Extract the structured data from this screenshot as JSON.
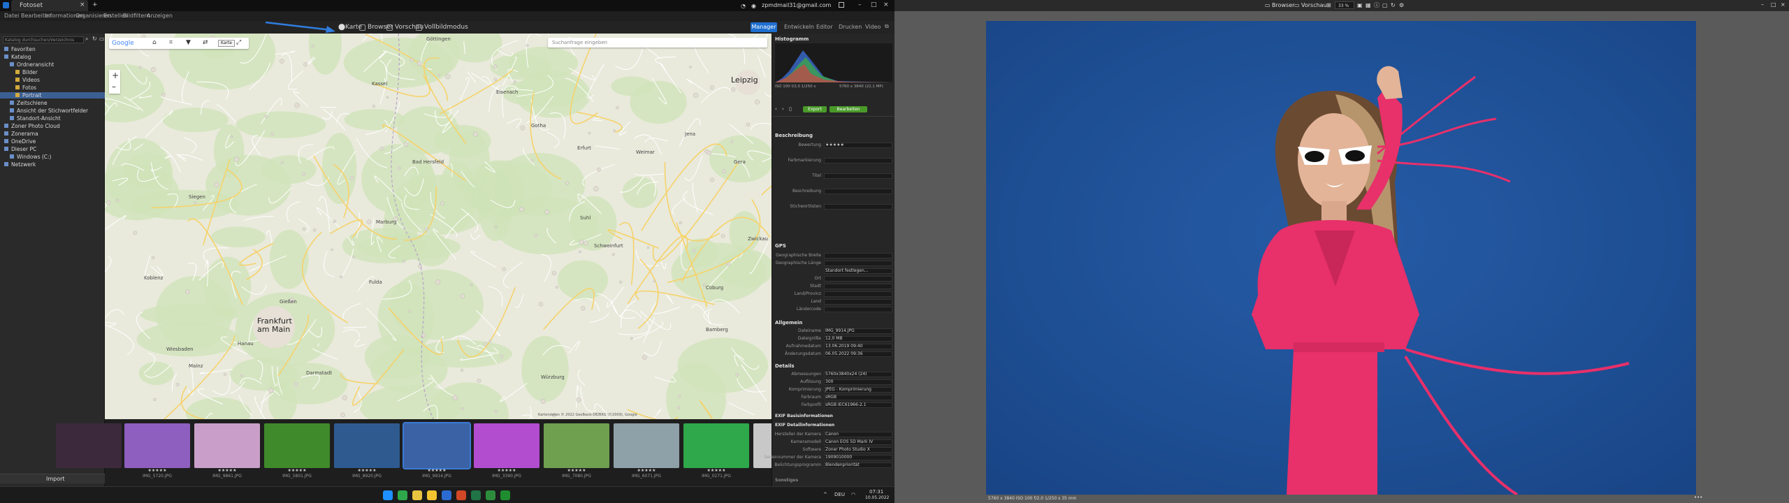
{
  "app": {
    "title": "Fotoset",
    "email": "zpmdmail31@gmail.com"
  },
  "menu": [
    "Datei",
    "Bearbeiten",
    "Informationen",
    "Organisieren",
    "Erstellen",
    "Bildfiltern",
    "Anzeigen"
  ],
  "toolbar": {
    "map": "Karte",
    "browser": "Browser",
    "preview": "Vorschau",
    "fullscreen": "Vollbildmodus",
    "tooltip": "Karte"
  },
  "modes": {
    "manager": "Manager",
    "develop": "Entwickeln",
    "editor": "Editor",
    "print": "Drucken",
    "video": "Video"
  },
  "sidebar": {
    "search_placeholder": "Katalog durchsuchen/Verzeichnis",
    "items": [
      {
        "label": "Favoriten",
        "sel": false,
        "indent": 0
      },
      {
        "label": "Katalog",
        "sel": false,
        "indent": 0
      },
      {
        "label": "Ordneransicht",
        "sel": false,
        "indent": 1
      },
      {
        "label": "Bilder",
        "sel": false,
        "indent": 2
      },
      {
        "label": "Videos",
        "sel": false,
        "indent": 2
      },
      {
        "label": "Fotos",
        "sel": false,
        "indent": 2
      },
      {
        "label": "Portrait",
        "sel": true,
        "indent": 2
      },
      {
        "label": "Zeitschiene",
        "sel": false,
        "indent": 1
      },
      {
        "label": "Ansicht der Stichwortfelder",
        "sel": false,
        "indent": 1
      },
      {
        "label": "Standort-Ansicht",
        "sel": false,
        "indent": 1
      },
      {
        "label": "Zoner Photo Cloud",
        "sel": false,
        "indent": 0
      },
      {
        "label": "Zonerama",
        "sel": false,
        "indent": 0
      },
      {
        "label": "OneDrive",
        "sel": false,
        "indent": 0
      },
      {
        "label": "Dieser PC",
        "sel": false,
        "indent": 0
      },
      {
        "label": "Windows (C:)",
        "sel": false,
        "indent": 1
      },
      {
        "label": "Netzwerk",
        "sel": false,
        "indent": 0
      }
    ],
    "import": "Import"
  },
  "map": {
    "search_placeholder": "Suchanfrage eingeben",
    "provider": "Google",
    "cities": [
      {
        "name": "Göttingen"
      },
      {
        "name": "Kassel"
      },
      {
        "name": "Erfurt"
      },
      {
        "name": "Marburg"
      },
      {
        "name": "Siegen"
      },
      {
        "name": "Koblenz"
      },
      {
        "name": "Fulda"
      },
      {
        "name": "Würzburg"
      },
      {
        "name": "Darmstadt"
      },
      {
        "name": "Mainz"
      },
      {
        "name": "Wiesbaden"
      },
      {
        "name": "Gießen"
      },
      {
        "name": "Eisenach"
      },
      {
        "name": "Gotha"
      },
      {
        "name": "Jena"
      },
      {
        "name": "Weimar"
      },
      {
        "name": "Gera"
      },
      {
        "name": "Zwickau"
      },
      {
        "name": "Hanau"
      },
      {
        "name": "Schweinfurt"
      },
      {
        "name": "Bamberg"
      },
      {
        "name": "Coburg"
      },
      {
        "name": "Suhl"
      },
      {
        "name": "Bad Hersfeld"
      }
    ],
    "big_cities": [
      "Leipzig",
      "Frankfurt am Main"
    ],
    "copyright": "Kartendaten © 2022 GeoBasis-DE/BKG (©2009), Google"
  },
  "filmstrip": [
    {
      "name": "",
      "color": "#3c2a3c",
      "stars": ""
    },
    {
      "name": "IMG_5720.JPG",
      "color": "#8e5fbf",
      "stars": "★★★★★"
    },
    {
      "name": "IMG_9861.JPG",
      "color": "#c99fc9",
      "stars": "★★★★★"
    },
    {
      "name": "IMG_5801.JPG",
      "color": "#3f8a2a",
      "stars": "★★★★★"
    },
    {
      "name": "IMG_8920.JPG",
      "color": "#2e5a90",
      "stars": "★★★★★"
    },
    {
      "name": "IMG_9914.JPG",
      "color": "#3a62a4",
      "stars": "★★★★★"
    },
    {
      "name": "IMG_3390.JPG",
      "color": "#b24dd0",
      "stars": "★★★★★"
    },
    {
      "name": "IMG_7080.JPG",
      "color": "#6ea050",
      "stars": "★★★★★"
    },
    {
      "name": "IMG_6071.JPG",
      "color": "#8ea0a8",
      "stars": "★★★★★"
    },
    {
      "name": "IMG_0271.JPG",
      "color": "#2ea84a",
      "stars": "★★★★★"
    },
    {
      "name": "",
      "color": "#c8c8c8",
      "stars": ""
    }
  ],
  "rpanel": {
    "histogram_title": "Histogramm",
    "exif_line1": "ISO 100   f/2,0   1/250 s",
    "exif_line2": "5760 x 3840 (22,1 MP)",
    "green_buttons": [
      "Export",
      "Bearbeiten"
    ],
    "beschreibung": "Beschreibung",
    "fields": [
      {
        "k": "Bewertung",
        "v": "★★★★★"
      },
      {
        "k": "Farbmarkierung",
        "v": ""
      },
      {
        "k": "Titel",
        "v": ""
      },
      {
        "k": "Beschreibung",
        "v": ""
      },
      {
        "k": "Stichwortlisten",
        "v": ""
      }
    ],
    "gps_title": "GPS",
    "gps_fields": [
      {
        "k": "Geographische Breite",
        "v": ""
      },
      {
        "k": "Geographische Länge",
        "v": ""
      },
      {
        "k": "",
        "v": "Standort festlegen..."
      },
      {
        "k": "Ort",
        "v": ""
      },
      {
        "k": "Stadt",
        "v": ""
      },
      {
        "k": "Land/Provinz",
        "v": ""
      },
      {
        "k": "Land",
        "v": ""
      },
      {
        "k": "Ländercode",
        "v": ""
      }
    ],
    "allgemein_title": "Allgemein",
    "allgemein": [
      {
        "k": "Dateiname",
        "v": "IMG_9914.JPG"
      },
      {
        "k": "Dateigröße",
        "v": "12,0 MB"
      },
      {
        "k": "Aufnahmedatum",
        "v": "13.06.2019 09:40"
      },
      {
        "k": "Änderungsdatum",
        "v": "06.05.2022 09:36"
      }
    ],
    "details_title": "Details",
    "details": [
      {
        "k": "Abmessungen",
        "v": "5760x3840x24 (24)"
      },
      {
        "k": "Auflösung",
        "v": "300"
      },
      {
        "k": "Komprimierung",
        "v": "JPEG - Komprimierung"
      },
      {
        "k": "Farbraum",
        "v": "sRGB"
      },
      {
        "k": "Farbprofil",
        "v": "sRGB IEC61966-2.1"
      }
    ],
    "exif_title": "EXIF Basisinformationen",
    "exif_detail_title": "EXIF Detailinformationen",
    "exif": [
      {
        "k": "Hersteller der Kamera",
        "v": "Canon"
      },
      {
        "k": "Kameramodell",
        "v": "Canon EOS 5D Mark IV"
      },
      {
        "k": "Software",
        "v": "Zoner Photo Studio X"
      },
      {
        "k": "Seriennummer der Kamera",
        "v": "1909010000"
      },
      {
        "k": "Belichtungsprogramm",
        "v": "Blendenpriorität"
      }
    ],
    "more": "Sonstiges"
  },
  "right_view": {
    "browser": "Browser",
    "preview": "Vorschau",
    "zoom": "33 %",
    "status": "5760 x 3840   ISO 100   f/2,0   1/250 s   35 mm"
  },
  "taskbar": {
    "lang": "DEU",
    "time": "07:31",
    "date": "10.05.2022"
  },
  "colors": {
    "accent": "#1e6fd0",
    "green": "#4a9a2a",
    "photo_bg": "#20539c",
    "dress": "#e8306a"
  }
}
